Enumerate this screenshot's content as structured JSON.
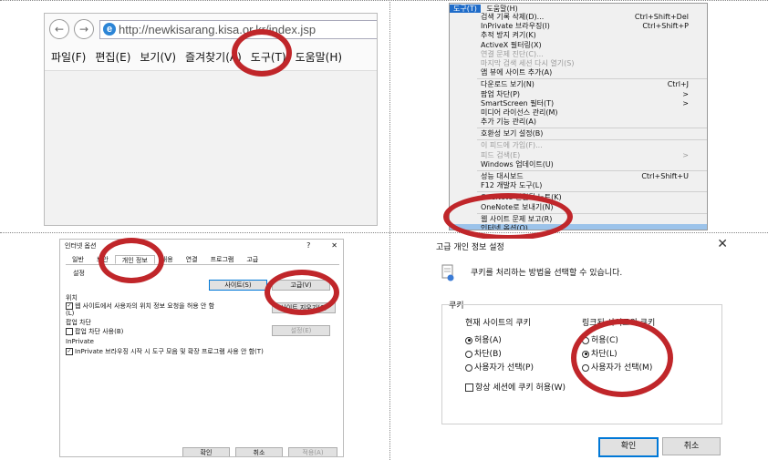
{
  "browser": {
    "url": "http://newkisarang.kisa.or.kr/index.jsp",
    "menu": [
      "파일(F)",
      "편집(E)",
      "보기(V)",
      "즐겨찾기(A)",
      "도구(T)",
      "도움말(H)"
    ]
  },
  "tools_menu": {
    "top": [
      "도구(T)",
      "도움말(H)"
    ],
    "items": [
      {
        "label": "검색 기록 삭제(D)...",
        "shortcut": "Ctrl+Shift+Del",
        "disabled": false
      },
      {
        "label": "InPrivate 브라우징(I)",
        "shortcut": "Ctrl+Shift+P",
        "disabled": false
      },
      {
        "label": "추적 방지 켜기(K)",
        "shortcut": "",
        "disabled": false
      },
      {
        "label": "ActiveX 필터링(X)",
        "shortcut": "",
        "disabled": false
      },
      {
        "label": "연결 문제 진단(C)...",
        "shortcut": "",
        "disabled": true
      },
      {
        "label": "마지막 검색 세션 다시 열기(S)",
        "shortcut": "",
        "disabled": true
      },
      {
        "label": "앱 뷰에 사이트 추가(A)",
        "shortcut": "",
        "disabled": false
      },
      {
        "sep": true
      },
      {
        "label": "다운로드 보기(N)",
        "shortcut": "Ctrl+J",
        "disabled": false
      },
      {
        "label": "팝업 차단(P)",
        "shortcut": ">",
        "disabled": false
      },
      {
        "label": "SmartScreen 필터(T)",
        "shortcut": ">",
        "disabled": false
      },
      {
        "label": "미디어 라이선스 관리(M)",
        "shortcut": "",
        "disabled": false
      },
      {
        "label": "추가 기능 관리(A)",
        "shortcut": "",
        "disabled": false
      },
      {
        "sep": true
      },
      {
        "label": "호환성 보기 설정(B)",
        "shortcut": "",
        "disabled": false
      },
      {
        "sep": true
      },
      {
        "label": "이 피드에 가입(F)...",
        "shortcut": "",
        "disabled": true
      },
      {
        "label": "피드 검색(E)",
        "shortcut": ">",
        "disabled": true
      },
      {
        "label": "Windows 업데이트(U)",
        "shortcut": "",
        "disabled": false
      },
      {
        "sep": true
      },
      {
        "label": "성능 대시보드",
        "shortcut": "Ctrl+Shift+U",
        "disabled": false
      },
      {
        "label": "F12 개발자 도구(L)",
        "shortcut": "",
        "disabled": false
      },
      {
        "sep": true
      },
      {
        "label": "OneNote 연결된 노트(K)",
        "shortcut": "",
        "disabled": false
      },
      {
        "label": "OneNote로 보내기(N)",
        "shortcut": "",
        "disabled": false
      },
      {
        "sep": true
      },
      {
        "label": "웹 사이트 문제 보고(R)",
        "shortcut": "",
        "disabled": false
      },
      {
        "label": "인터넷 옵션(O)",
        "shortcut": "",
        "disabled": false,
        "highlight": true
      }
    ]
  },
  "internet_options": {
    "title": "인터넷 옵션",
    "help": "?",
    "close": "✕",
    "tabs": [
      "일반",
      "보안",
      "개인 정보",
      "내용",
      "연결",
      "프로그램",
      "고급"
    ],
    "settings_label": "설정",
    "sites_button": "사이트(S)",
    "advanced_button": "고급(V)",
    "location_label": "위치",
    "location_check": "웹 사이트에서 사용자의 위치 정보 요청을 허용 안 함(L)",
    "clear_sites_button": "사이트 지우기(C)",
    "popup_label": "팝업 차단",
    "popup_check": "팝업 차단 사용(B)",
    "popup_settings_button": "설정(E)",
    "inprivate_label": "InPrivate",
    "inprivate_check": "InPrivate 브라우징 시작 시 도구 모음 및 확장 프로그램 사용 안 함(T)",
    "ok": "확인",
    "cancel": "취소",
    "apply": "적용(A)"
  },
  "advanced_privacy": {
    "title": "고급 개인 정보 설정",
    "close": "✕",
    "description": "쿠키를 처리하는 방법을 선택할 수 있습니다.",
    "group_label": "쿠키",
    "first_party": {
      "heading": "현재 사이트의 쿠키",
      "options": [
        "허용(A)",
        "차단(B)",
        "사용자가 선택(P)"
      ],
      "selected": "허용(A)"
    },
    "third_party": {
      "heading": "링크된 사이트의 쿠키",
      "options": [
        "허용(C)",
        "차단(L)",
        "사용자가 선택(M)"
      ],
      "selected": "차단(L)"
    },
    "session_check": "항상 세션에 쿠키 허용(W)",
    "ok": "확인",
    "cancel": "취소"
  }
}
